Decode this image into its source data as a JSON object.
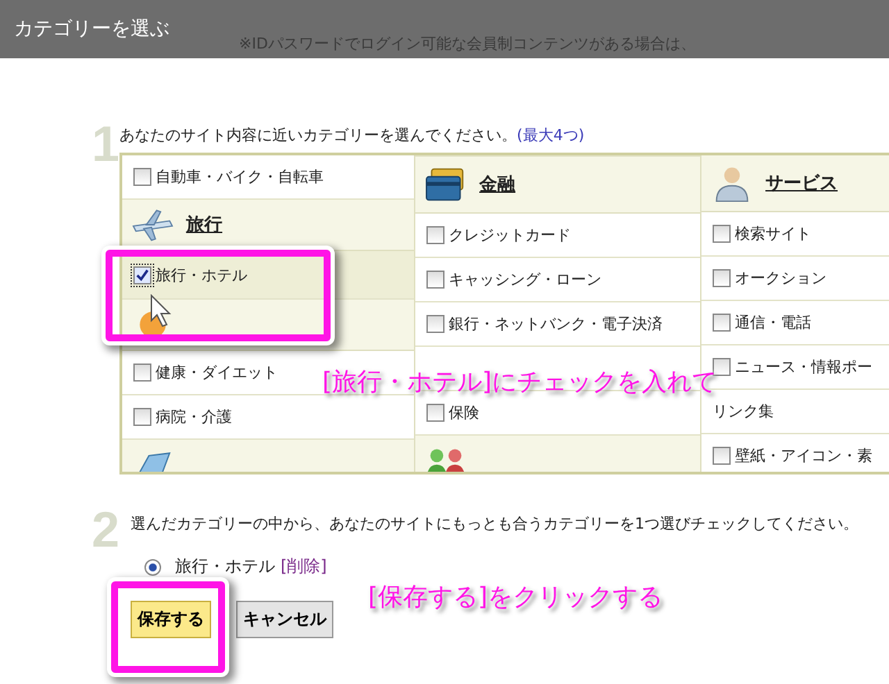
{
  "window": {
    "title": "カテゴリーを選ぶ",
    "background_text": "※IDパスワードでログイン可能な会員制コンテンツがある場合は、"
  },
  "step1": {
    "number": "1",
    "instruction": "あなたのサイト内容に近いカテゴリーを選んでください。",
    "limit": "(最大4つ)"
  },
  "columns": [
    [
      {
        "kind": "item",
        "label": "自動車・バイク・自転車",
        "checked": false
      },
      {
        "kind": "header",
        "label": "旅行"
      },
      {
        "kind": "item",
        "label": "旅行・ホテル",
        "checked": true,
        "highlight": true
      },
      {
        "kind": "header"
      },
      {
        "kind": "item",
        "label": "健康・ダイエット",
        "checked": false
      },
      {
        "kind": "item",
        "label": "病院・介護",
        "checked": false
      },
      {
        "kind": "header"
      }
    ],
    [
      {
        "kind": "spacer"
      },
      {
        "kind": "header",
        "label": "金融"
      },
      {
        "kind": "item",
        "label": "クレジットカード",
        "checked": false
      },
      {
        "kind": "item",
        "label": "キャッシング・ローン",
        "checked": false
      },
      {
        "kind": "item",
        "label": "銀行・ネットバンク・電子決済",
        "checked": false
      },
      {
        "kind": "blank"
      },
      {
        "kind": "item",
        "label": "保険",
        "checked": false
      },
      {
        "kind": "header"
      }
    ],
    [
      {
        "kind": "header",
        "label": "サービス"
      },
      {
        "kind": "item",
        "label": "検索サイト",
        "checked": false
      },
      {
        "kind": "item",
        "label": "オークション",
        "checked": false
      },
      {
        "kind": "item",
        "label": "通信・電話",
        "checked": false
      },
      {
        "kind": "item",
        "label": "ニュース・情報ポー",
        "checked": false
      },
      {
        "kind": "item",
        "label": "リンク集"
      },
      {
        "kind": "item",
        "label": "壁紙・アイコン・素",
        "checked": false
      }
    ]
  ],
  "step2": {
    "number": "2",
    "instruction": "選んだカテゴリーの中から、あなたのサイトにもっとも合うカテゴリーを1つ選びチェックしてください。",
    "choices": [
      {
        "label": "旅行・ホテル",
        "selected": true,
        "link": "[削除]"
      }
    ]
  },
  "buttons": [
    {
      "label": "保存する",
      "kind": "primary"
    },
    {
      "label": "キャンセル",
      "kind": "normal"
    }
  ],
  "annotations": [
    {
      "text": "[旅行・ホテル]にチェックを入れて"
    },
    {
      "text": "[保存する]をクリックする"
    }
  ]
}
